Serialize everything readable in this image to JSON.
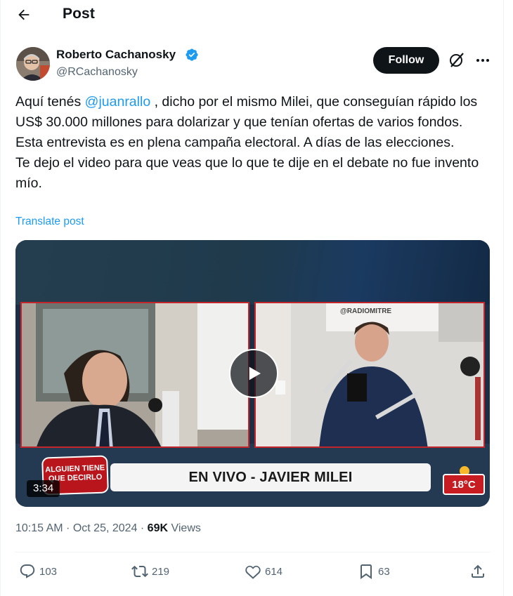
{
  "header": {
    "title": "Post",
    "back_icon": "arrow-left-icon"
  },
  "author": {
    "name": "Roberto Cachanosky",
    "handle": "@RCachanosky",
    "verified": true,
    "verified_color": "#1d9bf0"
  },
  "buttons": {
    "follow": "Follow",
    "grok_icon": "grok-icon",
    "more_icon": "more-icon"
  },
  "post": {
    "line1_before": "Aquí tenés ",
    "mention": "@juanrallo",
    "line1_after": " , dicho por el mismo Milei, que conseguían rápido los US$ 30.000 millones para dolarizar y que tenían ofertas de varios fondos.",
    "line2": "Esta entrevista es en plena campaña electoral. A días de las elecciones.",
    "line3": "Te dejo el video para que veas que lo que te dije en el debate no fue invento mío.",
    "translate": "Translate post"
  },
  "video": {
    "duration": "3:34",
    "lower_third": "EN VIVO - JAVIER MILEI",
    "logo_text": "ALGUIEN TIENE QUE DECIRLO",
    "temperature": "18°C",
    "watermark": "@RADIOMITRE"
  },
  "meta": {
    "time": "10:15 AM",
    "sep": " · ",
    "date": "Oct 25, 2024",
    "sep2": " · ",
    "views_count": "69K",
    "views_label": " Views"
  },
  "actions": {
    "replies": "103",
    "reposts": "219",
    "likes": "614",
    "bookmarks": "63"
  },
  "colors": {
    "accent": "#1d9bf0",
    "text": "#0f1419",
    "muted": "#536471",
    "broadcast_red": "#c4252b"
  }
}
